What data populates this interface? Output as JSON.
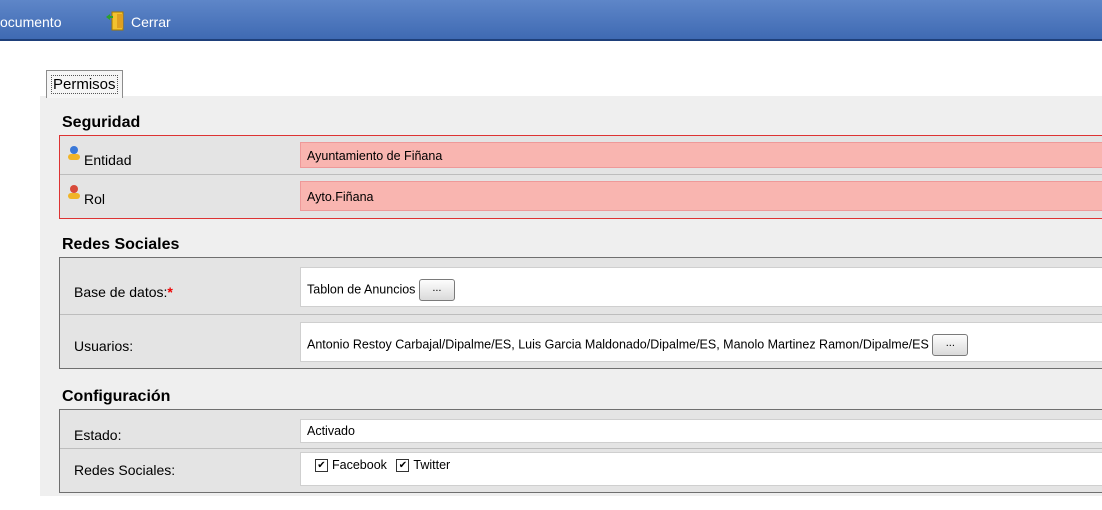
{
  "toolbar": {
    "documento_label": "ocumento",
    "cerrar_label": "Cerrar"
  },
  "tab": {
    "label": "Permisos"
  },
  "seguridad": {
    "title": "Seguridad",
    "entidad_label": "Entidad",
    "entidad_value": "Ayuntamiento de Fiñana",
    "rol_label": "Rol",
    "rol_value": "Ayto.Fiñana"
  },
  "redes": {
    "title": "Redes Sociales",
    "base_label": "Base de datos:",
    "base_required": "*",
    "base_value": "Tablon de Anuncios",
    "usuarios_label": "Usuarios:",
    "usuarios_value": "Antonio Restoy Carbajal/Dipalme/ES, Luis Garcia Maldonado/Dipalme/ES, Manolo Martinez Ramon/Dipalme/ES",
    "browse_button": "..."
  },
  "config": {
    "title": "Configuración",
    "estado_label": "Estado:",
    "estado_value": "Activado",
    "redes_label": "Redes Sociales:",
    "facebook_label": "Facebook",
    "twitter_label": "Twitter",
    "facebook_checked": true,
    "twitter_checked": true
  },
  "colors": {
    "toolbar": "#4a75bc",
    "required": "#ee0000",
    "highlight": "#f9b5b0",
    "security_border": "#dd3333"
  }
}
